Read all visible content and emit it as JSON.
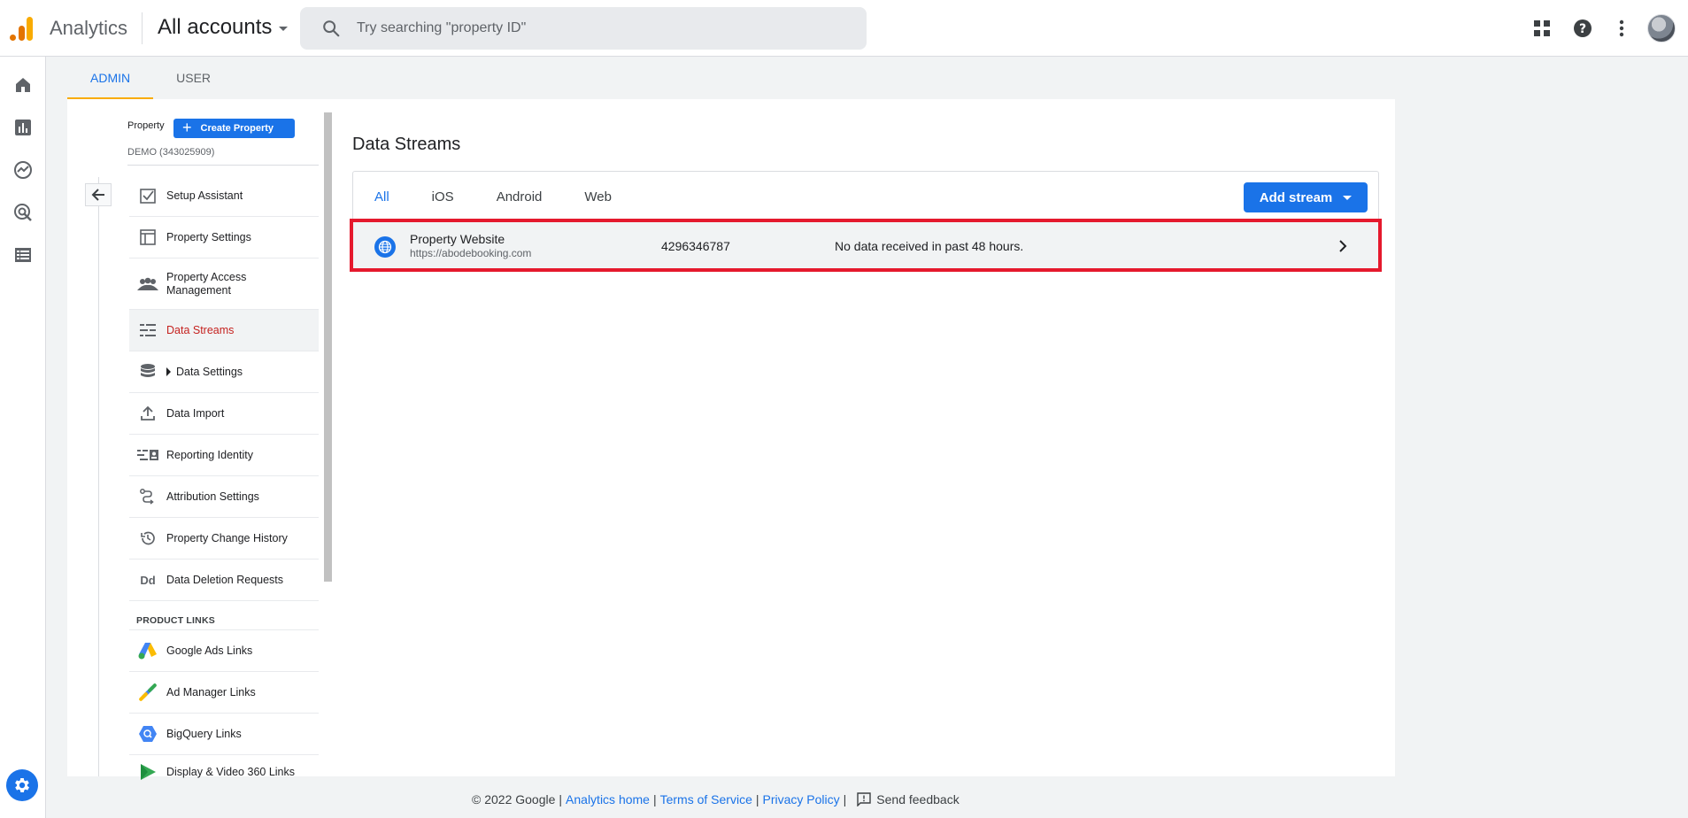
{
  "header": {
    "app_name": "Analytics",
    "account_selector": "All accounts",
    "search_placeholder": "Try searching \"property ID\""
  },
  "admin_tabs": [
    "ADMIN",
    "USER"
  ],
  "property": {
    "label": "Property",
    "create_button": "Create Property",
    "name": "DEMO (343025909)"
  },
  "menu": {
    "items": [
      {
        "label": "Setup Assistant",
        "icon": "checkbox-icon"
      },
      {
        "label": "Property Settings",
        "icon": "layout-icon"
      },
      {
        "label": "Property Access Management",
        "icon": "people-icon"
      },
      {
        "label": "Data Streams",
        "icon": "streams-icon",
        "active": true
      },
      {
        "label": "Data Settings",
        "icon": "database-icon"
      },
      {
        "label": "Data Import",
        "icon": "upload-icon"
      },
      {
        "label": "Reporting Identity",
        "icon": "identity-icon"
      },
      {
        "label": "Attribution Settings",
        "icon": "attribution-icon"
      },
      {
        "label": "Property Change History",
        "icon": "history-icon"
      },
      {
        "label": "Data Deletion Requests",
        "icon": "dd-icon"
      }
    ],
    "section_title": "PRODUCT LINKS",
    "links": [
      {
        "label": "Google Ads Links",
        "icon": "google-ads-icon"
      },
      {
        "label": "Ad Manager Links",
        "icon": "ad-manager-icon"
      },
      {
        "label": "BigQuery Links",
        "icon": "bigquery-icon"
      },
      {
        "label": "Display & Video 360 Links",
        "icon": "dv360-icon"
      }
    ],
    "dd_glyph": "Dd"
  },
  "data_streams": {
    "title": "Data Streams",
    "filters": [
      "All",
      "iOS",
      "Android",
      "Web"
    ],
    "add_button": "Add stream",
    "stream": {
      "name": "Property Website",
      "url": "https://abodebooking.com",
      "id": "4296346787",
      "status": "No data received in past 48 hours."
    }
  },
  "footer": {
    "copyright": "© 2022 Google",
    "links": [
      "Analytics home",
      "Terms of Service",
      "Privacy Policy"
    ],
    "feedback": "Send feedback"
  },
  "colors": {
    "accent": "#1a73e8",
    "highlight_border": "#e5192d",
    "active_menu_text": "#c5221f",
    "tab_underline": "#f9ab00"
  }
}
